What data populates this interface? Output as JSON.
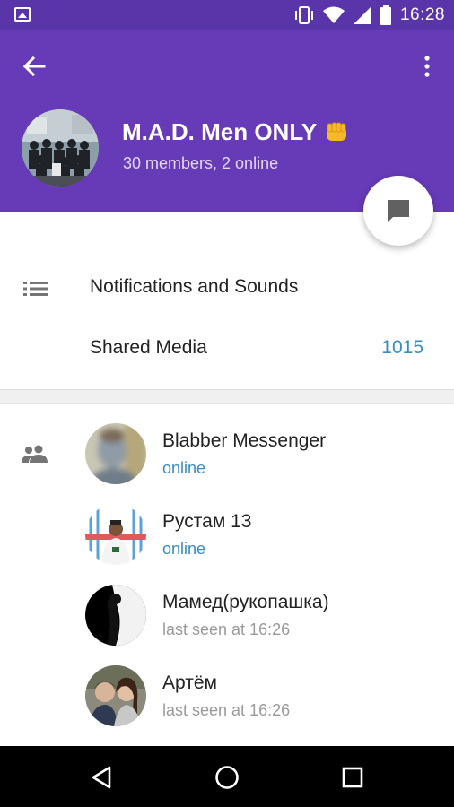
{
  "status_bar": {
    "time": "16:28",
    "icons": [
      "gallery-icon",
      "vibrate-icon",
      "wifi-icon",
      "signal-icon",
      "battery-icon"
    ]
  },
  "header": {
    "back_icon": "arrow-back-icon",
    "menu_icon": "more-vert-icon",
    "title": "M.A.D. Men ONLY",
    "title_emoji": "fist-emoji",
    "subtitle": "30 members, 2 online",
    "background_color": "#673ab7"
  },
  "fab": {
    "icon": "chat-bubble-icon"
  },
  "settings": {
    "items": [
      {
        "icon": "list-icon",
        "label": "Notifications and Sounds",
        "value": ""
      },
      {
        "icon": "",
        "label": "Shared Media",
        "value": "1015"
      }
    ]
  },
  "members": {
    "section_icon": "group-icon",
    "items": [
      {
        "name": "Blabber Messenger",
        "status": "online",
        "online": true
      },
      {
        "name": "Рустам 13",
        "status": "online",
        "online": true
      },
      {
        "name": "Мамед(рукопашка)",
        "status": "last seen at 16:26",
        "online": false
      },
      {
        "name": "Артём",
        "status": "last seen at 16:26",
        "online": false
      }
    ]
  },
  "colors": {
    "accent": "#3a8bbf",
    "header": "#673ab7",
    "status_bar": "#5a34a9",
    "secondary_text": "#9a9a9a"
  },
  "nav_bar": {
    "buttons": [
      "back-triangle-icon",
      "home-circle-icon",
      "recents-square-icon"
    ]
  }
}
